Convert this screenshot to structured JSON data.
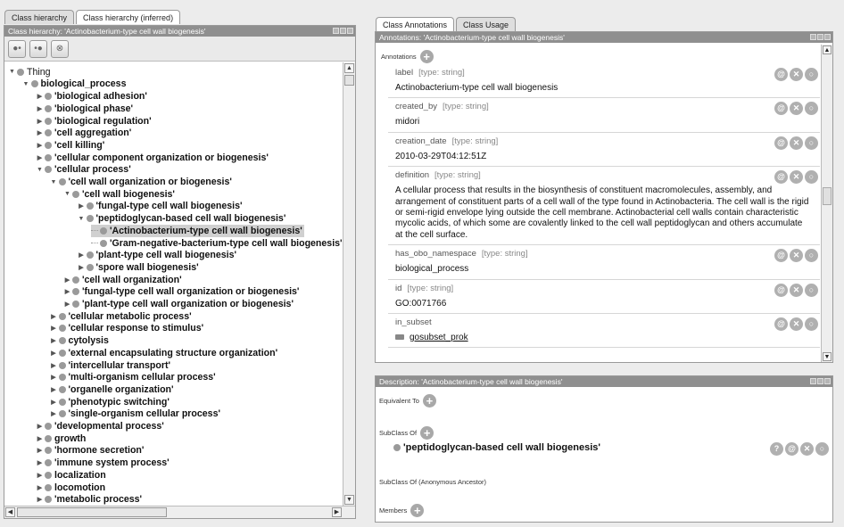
{
  "left_tabs": [
    "Class hierarchy",
    "Class hierarchy (inferred)"
  ],
  "left_panel": {
    "title": "Class hierarchy: 'Actinobacterium-type cell wall biogenesis'",
    "toolbar": [
      "add-subclass-icon",
      "add-sibling-icon",
      "delete-class-icon"
    ],
    "tree": [
      {
        "label": "Thing",
        "depth": 0,
        "expanded": true,
        "plain": true
      },
      {
        "label": "biological_process",
        "depth": 1,
        "expanded": true
      },
      {
        "label": "'biological adhesion'",
        "depth": 2
      },
      {
        "label": "'biological phase'",
        "depth": 2
      },
      {
        "label": "'biological regulation'",
        "depth": 2
      },
      {
        "label": "'cell aggregation'",
        "depth": 2
      },
      {
        "label": "'cell killing'",
        "depth": 2
      },
      {
        "label": "'cellular component organization or biogenesis'",
        "depth": 2
      },
      {
        "label": "'cellular process'",
        "depth": 2,
        "expanded": true
      },
      {
        "label": "'cell wall organization or biogenesis'",
        "depth": 3,
        "expanded": true
      },
      {
        "label": "'cell wall biogenesis'",
        "depth": 4,
        "expanded": true
      },
      {
        "label": "'fungal-type cell wall biogenesis'",
        "depth": 5
      },
      {
        "label": "'peptidoglycan-based cell wall biogenesis'",
        "depth": 5,
        "expanded": true
      },
      {
        "label": "'Actinobacterium-type cell wall biogenesis'",
        "depth": 6,
        "leaf": true,
        "selected": true
      },
      {
        "label": "'Gram-negative-bacterium-type cell wall biogenesis'",
        "depth": 6,
        "leaf": true
      },
      {
        "label": "'plant-type cell wall biogenesis'",
        "depth": 5
      },
      {
        "label": "'spore wall biogenesis'",
        "depth": 5
      },
      {
        "label": "'cell wall organization'",
        "depth": 4
      },
      {
        "label": "'fungal-type cell wall organization or biogenesis'",
        "depth": 4
      },
      {
        "label": "'plant-type cell wall organization or biogenesis'",
        "depth": 4
      },
      {
        "label": "'cellular metabolic process'",
        "depth": 3
      },
      {
        "label": "'cellular response to stimulus'",
        "depth": 3
      },
      {
        "label": "cytolysis",
        "depth": 3
      },
      {
        "label": "'external encapsulating structure organization'",
        "depth": 3
      },
      {
        "label": "'intercellular transport'",
        "depth": 3
      },
      {
        "label": "'multi-organism cellular process'",
        "depth": 3
      },
      {
        "label": "'organelle organization'",
        "depth": 3
      },
      {
        "label": "'phenotypic switching'",
        "depth": 3
      },
      {
        "label": "'single-organism cellular process'",
        "depth": 3
      },
      {
        "label": "'developmental process'",
        "depth": 2
      },
      {
        "label": "growth",
        "depth": 2
      },
      {
        "label": "'hormone secretion'",
        "depth": 2
      },
      {
        "label": "'immune system process'",
        "depth": 2
      },
      {
        "label": "localization",
        "depth": 2
      },
      {
        "label": "locomotion",
        "depth": 2
      },
      {
        "label": "'metabolic process'",
        "depth": 2
      }
    ]
  },
  "right_tabs": [
    "Class Annotations",
    "Class Usage"
  ],
  "annotations_panel": {
    "title": "Annotations: 'Actinobacterium-type cell wall biogenesis'",
    "section_label": "Annotations",
    "rows": [
      {
        "name": "label",
        "type": "[type: string]",
        "value": "Actinobacterium-type cell wall biogenesis"
      },
      {
        "name": "created_by",
        "type": "[type: string]",
        "value": "midori"
      },
      {
        "name": "creation_date",
        "type": "[type: string]",
        "value": "2010-03-29T04:12:51Z"
      },
      {
        "name": "definition",
        "type": "[type: string]",
        "value": "A cellular process that results in the biosynthesis of constituent macromolecules, assembly, and arrangement of constituent parts of a cell wall of the type found in Actinobacteria. The cell wall is the rigid or semi-rigid envelope lying outside the cell membrane. Actinobacterial cell walls contain characteristic mycolic acids, of which some are covalently linked to the cell wall peptidoglycan and others accumulate at the cell surface."
      },
      {
        "name": "has_obo_namespace",
        "type": "[type: string]",
        "value": "biological_process"
      },
      {
        "name": "id",
        "type": "[type: string]",
        "value": "GO:0071766"
      },
      {
        "name": "in_subset",
        "type": "",
        "value": "gosubset_prok",
        "subset": true
      }
    ]
  },
  "description_panel": {
    "title": "Description: 'Actinobacterium-type cell wall biogenesis'",
    "equivalent_to": "Equivalent To",
    "subclass_of": "SubClass Of",
    "subclass_value": "'peptidoglycan-based cell wall biogenesis'",
    "subclass_anon": "SubClass Of (Anonymous Ancestor)",
    "members": "Members"
  }
}
